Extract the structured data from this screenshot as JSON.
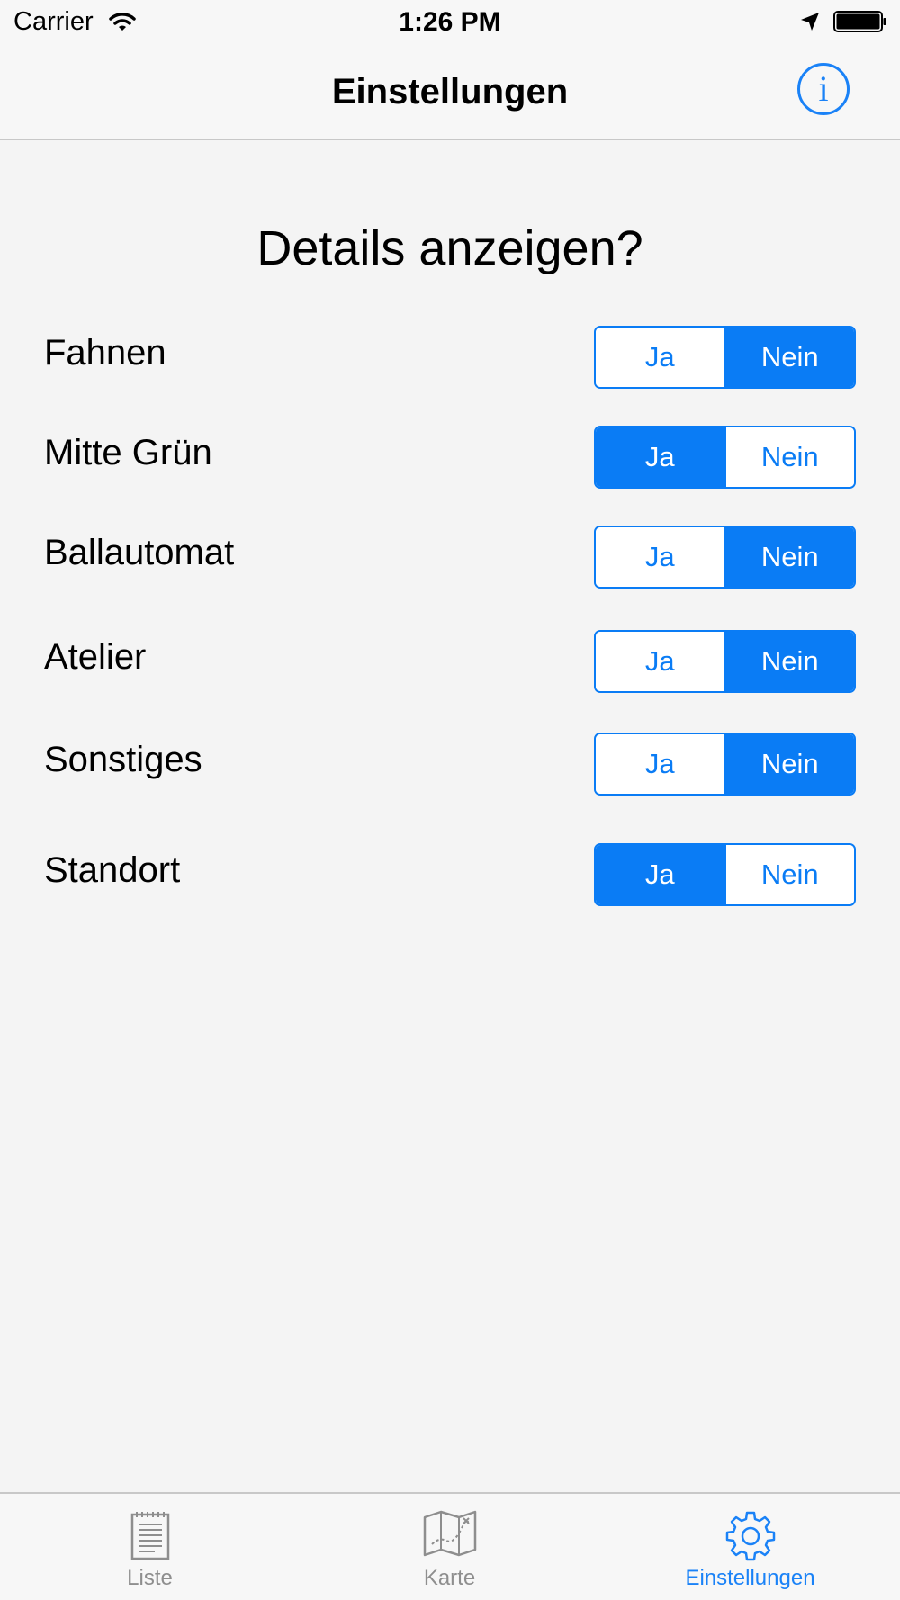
{
  "status_bar": {
    "carrier": "Carrier",
    "time": "1:26 PM"
  },
  "nav_bar": {
    "title": "Einstellungen",
    "info_glyph": "i"
  },
  "content": {
    "heading": "Details anzeigen?",
    "rows": [
      {
        "label": "Fahnen",
        "yes": "Ja",
        "no": "Nein",
        "selected": "Nein"
      },
      {
        "label": "Mitte Grün",
        "yes": "Ja",
        "no": "Nein",
        "selected": "Ja"
      },
      {
        "label": "Ballautomat",
        "yes": "Ja",
        "no": "Nein",
        "selected": "Nein"
      },
      {
        "label": "Atelier",
        "yes": "Ja",
        "no": "Nein",
        "selected": "Nein"
      },
      {
        "label": "Sonstiges",
        "yes": "Ja",
        "no": "Nein",
        "selected": "Nein"
      },
      {
        "label": "Standort",
        "yes": "Ja",
        "no": "Nein",
        "selected": "Ja"
      }
    ]
  },
  "tab_bar": {
    "active": "Einstellungen",
    "tabs": [
      {
        "label": "Liste",
        "icon": "list-document-icon"
      },
      {
        "label": "Karte",
        "icon": "map-icon"
      },
      {
        "label": "Einstellungen",
        "icon": "gear-icon"
      }
    ]
  },
  "colors": {
    "accent": "#0a7cf5",
    "background": "#f4f4f4",
    "inactive_tab": "#8e8e8e"
  }
}
